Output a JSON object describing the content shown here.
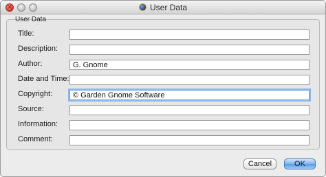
{
  "window": {
    "title": "User Data"
  },
  "group": {
    "label": "User Data"
  },
  "fields": [
    {
      "label": "Title:",
      "value": ""
    },
    {
      "label": "Description:",
      "value": ""
    },
    {
      "label": "Author:",
      "value": "G. Gnome"
    },
    {
      "label": "Date and Time:",
      "value": ""
    },
    {
      "label": "Copyright:",
      "value": "© Garden Gnome Software"
    },
    {
      "label": "Source:",
      "value": ""
    },
    {
      "label": "Information:",
      "value": ""
    },
    {
      "label": "Comment:",
      "value": ""
    }
  ],
  "buttons": {
    "cancel_label": "Cancel",
    "ok_label": "OK"
  },
  "focused_field": "Copyright:",
  "colors": {
    "focus_ring": "#8fb8ec",
    "default_button": "#5a9be4",
    "close_button": "#e0443a"
  }
}
